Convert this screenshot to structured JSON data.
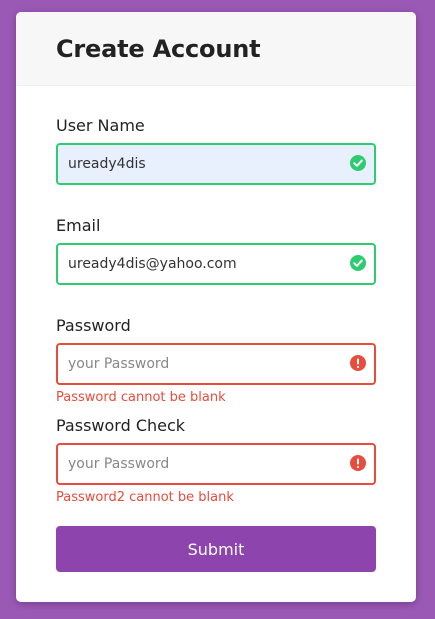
{
  "form": {
    "title": "Create Account",
    "fields": [
      {
        "label": "User Name",
        "value": "uready4dis",
        "placeholder": "",
        "status": "success"
      },
      {
        "label": "Email",
        "value": "uready4dis@yahoo.com",
        "placeholder": "",
        "status": "success"
      },
      {
        "label": "Password",
        "value": "",
        "placeholder": "your Password",
        "status": "error",
        "error": "Password cannot be blank"
      },
      {
        "label": "Password Check",
        "value": "",
        "placeholder": "your Password",
        "status": "error",
        "error": "Password2 cannot be blank"
      }
    ],
    "submit_label": "Submit"
  },
  "colors": {
    "background": "#9b59b6",
    "success": "#2ecc71",
    "error": "#e74c3c",
    "button": "#8e44ad"
  },
  "icons": {
    "success": "check-circle-icon",
    "error": "exclamation-circle-icon"
  }
}
